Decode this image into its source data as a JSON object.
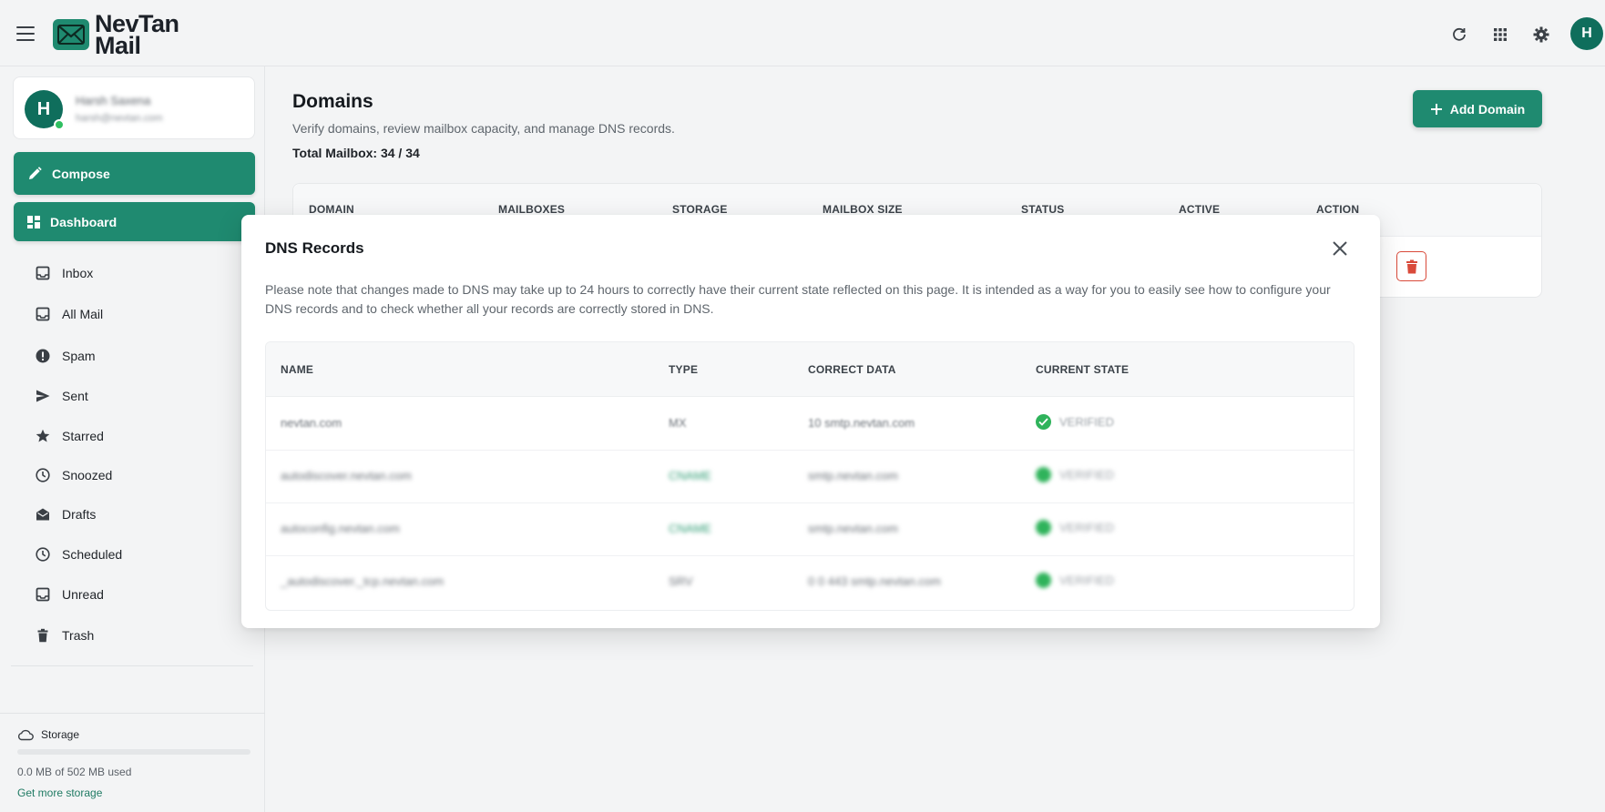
{
  "app": {
    "logo_line1": "NevTan",
    "logo_line2": "Mail",
    "avatar_initial": "H"
  },
  "profile": {
    "initial": "H",
    "name": "Harsh Saxena",
    "email": "harsh@nevtan.com"
  },
  "sidebar": {
    "compose_label": "Compose",
    "dashboard_label": "Dashboard",
    "items": [
      {
        "label": "Inbox",
        "icon": "inbox-icon"
      },
      {
        "label": "All Mail",
        "icon": "all-mail-icon"
      },
      {
        "label": "Spam",
        "icon": "spam-icon"
      },
      {
        "label": "Sent",
        "icon": "send-icon"
      },
      {
        "label": "Starred",
        "icon": "star-icon"
      },
      {
        "label": "Snoozed",
        "icon": "clock-icon"
      },
      {
        "label": "Drafts",
        "icon": "drafts-icon"
      },
      {
        "label": "Scheduled",
        "icon": "clock-icon"
      },
      {
        "label": "Unread",
        "icon": "unread-icon"
      },
      {
        "label": "Trash",
        "icon": "trash-icon"
      }
    ],
    "storage": {
      "title": "Storage",
      "used_text": "0.0 MB of 502 MB used",
      "used_fraction": 0.0,
      "link": "Get more storage"
    }
  },
  "main": {
    "title": "Domains",
    "subtitle": "Verify domains, review mailbox capacity, and manage DNS records.",
    "total": "Total Mailbox: 34 / 34",
    "add_button": "Add Domain",
    "columns": [
      "DOMAIN",
      "MAILBOXES",
      "STORAGE",
      "MAILBOX SIZE",
      "STATUS",
      "ACTIVE",
      "ACTION"
    ]
  },
  "modal": {
    "title": "DNS Records",
    "note": "Please note that changes made to DNS may take up to 24 hours to correctly have their current state reflected on this page. It is intended as a way for you to easily see how to configure your DNS records and to check whether all your records are correctly stored in DNS.",
    "columns": [
      "NAME",
      "TYPE",
      "CORRECT DATA",
      "CURRENT STATE"
    ],
    "rows": [
      {
        "name": "nevtan.com",
        "type": "MX",
        "data": "10 smtp.nevtan.com",
        "state": "VERIFIED"
      },
      {
        "name": "autodiscover.nevtan.com",
        "type": "CNAME",
        "data": "smtp.nevtan.com",
        "state": "VERIFIED"
      },
      {
        "name": "autoconfig.nevtan.com",
        "type": "CNAME",
        "data": "smtp.nevtan.com",
        "state": "VERIFIED"
      },
      {
        "name": "_autodiscover._tcp.nevtan.com",
        "type": "SRV",
        "data": "0 0 443 smtp.nevtan.com",
        "state": "VERIFIED"
      }
    ]
  },
  "colors": {
    "brand": "#1f8a70",
    "brand_dark": "#0f6e5c",
    "verified": "#2fb35b",
    "danger": "#d94a3a"
  }
}
